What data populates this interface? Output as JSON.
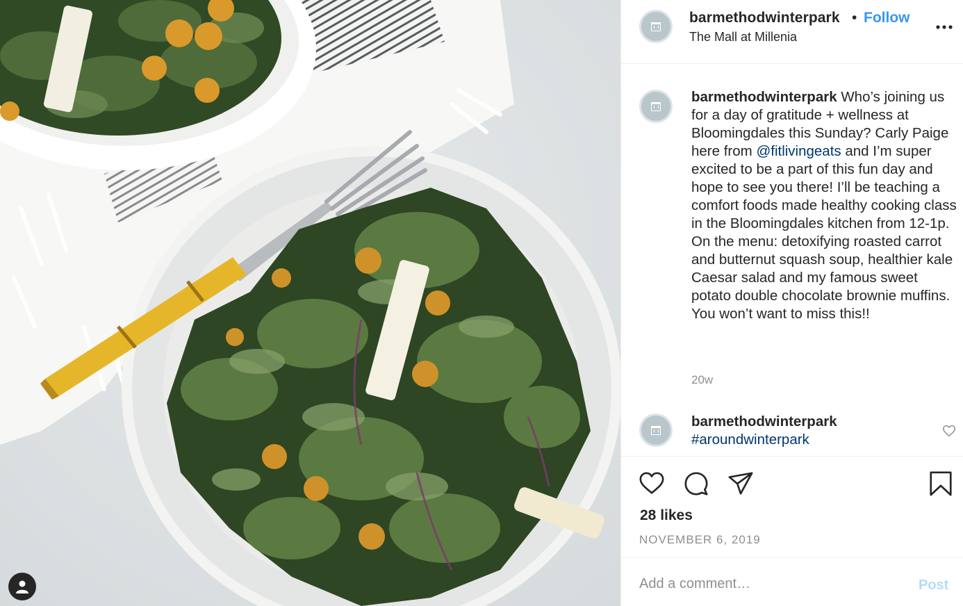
{
  "post": {
    "photo_alt": "kale salad photo",
    "header": {
      "username": "barmethodwinterpark",
      "separator": "•",
      "follow_label": "Follow",
      "location": "The Mall at Millenia",
      "more_icon": "more-horizontal-icon"
    },
    "caption": {
      "username": "barmethodwinterpark",
      "text_before": "Who’s joining us for a day of gratitude + wellness at Bloomingdales this Sunday? Carly Paige here from",
      "mention": "@fitlivingeats",
      "text_after": "and I’m super excited to be a part of this fun day and hope to see you there! I’ll be teaching a comfort foods made healthy cooking class in the Bloomingdales kitchen from 12-1p. On the menu: detoxifying roasted carrot and butternut squash soup, healthier kale Caesar salad and my famous sweet potato double chocolate brownie muffins. You won’t want to miss this!!",
      "time_ago": "20w"
    },
    "comment": {
      "username": "barmethodwinterpark",
      "hashtag": "#aroundwinterpark"
    },
    "actions": {
      "like_icon": "heart-icon",
      "comment_icon": "comment-bubble-icon",
      "share_icon": "paper-plane-icon",
      "save_icon": "bookmark-icon"
    },
    "likes": "28 likes",
    "date": "NOVEMBER 6, 2019",
    "comment_box": {
      "placeholder": "Add a comment…",
      "post_label": "Post"
    }
  },
  "colors": {
    "link_blue": "#3897f0",
    "mention_blue": "#00376b",
    "muted_gray": "#8e8e8e",
    "post_disabled": "#b3dbff"
  }
}
